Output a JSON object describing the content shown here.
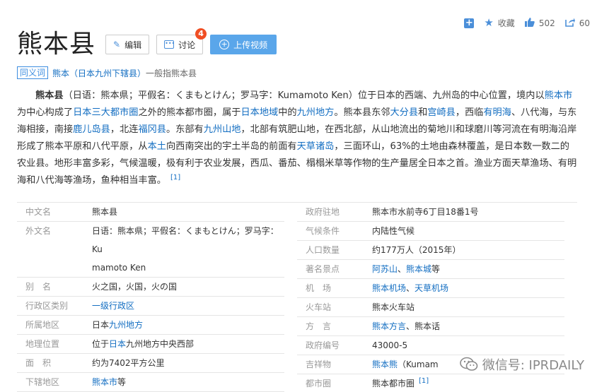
{
  "actions": {
    "favorite": "收藏",
    "like_count": "502",
    "share_count": "60"
  },
  "title": "熊本县",
  "buttons": {
    "edit": "编辑",
    "discuss": "讨论",
    "discuss_badge": "4",
    "upload": "上传视频"
  },
  "synonym": {
    "tag": "同义词",
    "link": "熊本（日本九州下辖县）",
    "rest": "一般指熊本县"
  },
  "summary": {
    "lead": "熊本县",
    "t1": "（日语：熊本県；平假名：くまもとけん；罗马字：Kumamoto Ken）位于日本的西端、九州岛的中心位置，境内以",
    "l1": "熊本市",
    "t2": "为中心构成了",
    "l2": "日本三大都市圈",
    "t3": "之外的熊本都市圈，属于",
    "l3": "日本地域",
    "t4": "中的",
    "l4": "九州地方",
    "t5": "。熊本县东邻",
    "l5": "大分县",
    "t6": "和",
    "l6": "宫崎县",
    "t7": "，西临",
    "l7": "有明海",
    "t8": "、八代海，与东海相接，南接",
    "l8": "鹿儿岛县",
    "t9": "，北连",
    "l9": "福冈县",
    "t10": "。东部有",
    "l10": "九州山地",
    "t11": "，北部有筑肥山地，在西北部，从山地流出的菊地川和球磨川等河流在有明海沿岸形成了熊本平原和八代平原，从",
    "l11": "本土",
    "t12": "向西南突出的宇土半岛的前面有",
    "l12": "天草诸岛",
    "t13": "，三面环山，63%的土地由森林覆盖，是日本数一数二的农业县。地形丰富多彩，气候温暖，极有利于农业发展，西瓜、番茄、榻榻米草等作物的生产量居全日本之首。渔业方面天草渔场、有明海和八代海等渔场，鱼种相当丰富。",
    "ref": "[1]"
  },
  "info_left": {
    "chinese_name_k": "中文名",
    "chinese_name_v": "熊本县",
    "foreign_name_k": "外文名",
    "foreign_name_v1": "日语：熊本県；平假名：くまもとけん；罗马字：Ku",
    "foreign_name_v2": "mamoto Ken",
    "alias_k": "别　名",
    "alias_v": "火之国，火国，火の国",
    "admin_type_k": "行政区类别",
    "admin_type_v": "一级行政区",
    "region_k": "所属地区",
    "region_v_pre": "日本",
    "region_v_link": "九州地方",
    "location_k": "地理位置",
    "location_v_pre": "位于",
    "location_v_link": "日本",
    "location_v_post": "九州地方中央西部",
    "area_k": "面　积",
    "area_v": "约为7402平方公里",
    "sub_k": "下辖地区",
    "sub_v_link": "熊本市",
    "sub_v_post": "等"
  },
  "info_right": {
    "gov_k": "政府驻地",
    "gov_v": "熊本市水前寺6丁目18番1号",
    "climate_k": "气候条件",
    "climate_v": "内陆性气候",
    "pop_k": "人口数量",
    "pop_v": "约177万人（2015年）",
    "spots_k": "著名景点",
    "spots_l1": "阿苏山",
    "spots_sep": "、",
    "spots_l2": "熊本城",
    "spots_post": "等",
    "airport_k": "机　场",
    "airport_l1": "熊本机场",
    "airport_sep": "、",
    "airport_l2": "天草机场",
    "station_k": "火车站",
    "station_v": "熊本火车站",
    "dialect_k": "方　言",
    "dialect_l1": "熊本方言",
    "dialect_post": "、熊本话",
    "code_k": "政府编号",
    "code_v": "43000-5",
    "mascot_k": "吉祥物",
    "mascot_l": "熊本熊",
    "mascot_post": "（Kumam",
    "metro_k": "都市圈",
    "metro_v": "熊本都市圈",
    "metro_ref": "[1]"
  },
  "watermark": "微信号: IPRDAILY"
}
